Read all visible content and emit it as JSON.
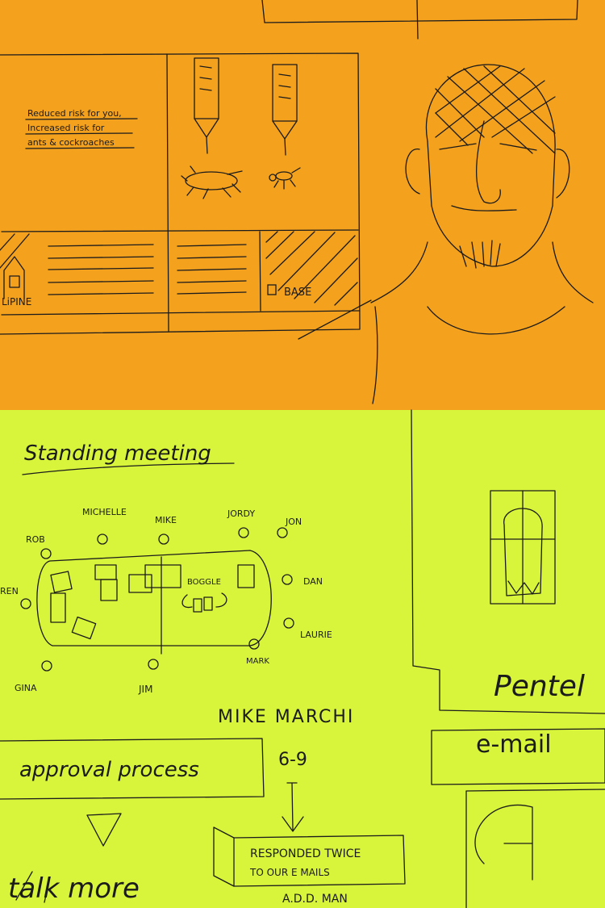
{
  "colors": {
    "top_panel": "#f4a11e",
    "bottom_panel": "#d8f53b",
    "ink": "#1b1b1b"
  },
  "top": {
    "risk_line1": "Reduced risk for you,",
    "risk_line2": "Increased risk for",
    "risk_line3": "ants & cockroaches",
    "brand_left": "LiPINE",
    "brand_right": "BASE"
  },
  "bottom": {
    "heading": "Standing meeting",
    "names": [
      "ROB",
      "MICHELLE",
      "MIKE",
      "JORDY",
      "JON",
      "REN",
      "DAN",
      "LAURIE",
      "GINA",
      "JIM",
      "MARK"
    ],
    "boggle": "BOGGLE",
    "mike_marchi": "MIKE MARCHI",
    "approval": "approval process",
    "time": "6-9",
    "responded1": "RESPONDED TWICE",
    "responded2": "TO OUR E MAILS",
    "add": "A.D.D. MAN",
    "pentel": "Pentel",
    "email": "e-mail",
    "talk": "talk more"
  }
}
